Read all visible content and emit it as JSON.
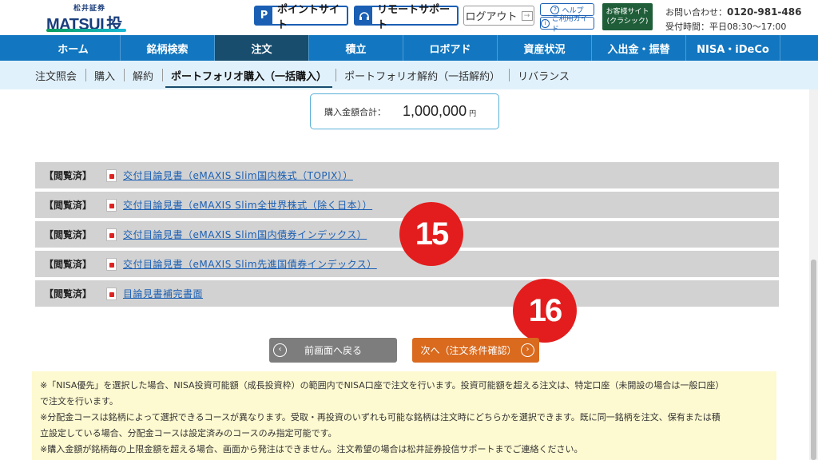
{
  "header": {
    "logo_small": "松井証券",
    "logo_main": "MATSUI",
    "logo_kanji": "投信",
    "point_icon": "P",
    "point_label": "ポイントサイト",
    "remote_label": "リモートサポート",
    "logout_label": "ログアウト",
    "help_label": "ヘルプ",
    "guide_label": "ご利用ガイド",
    "classic_line1": "お客様サイト",
    "classic_line2": "(クラシック)",
    "contact_label": "お問い合わせ：",
    "contact_phone": "0120-981-486",
    "hours": "受付時間：平日08:30～17:00"
  },
  "nav": {
    "items": [
      {
        "label": "ホーム"
      },
      {
        "label": "銘柄検索"
      },
      {
        "label": "注文"
      },
      {
        "label": "積立"
      },
      {
        "label": "ロボアド"
      },
      {
        "label": "資産状況"
      },
      {
        "label": "入出金・振替"
      },
      {
        "label": "NISA・iDeCo"
      }
    ],
    "active_index": 2
  },
  "subnav": {
    "items": [
      {
        "label": "注文照会"
      },
      {
        "label": "購入"
      },
      {
        "label": "解約"
      },
      {
        "label": "ポートフォリオ購入（一括購入）"
      },
      {
        "label": "ポートフォリオ解約（一括解約）"
      },
      {
        "label": "リバランス"
      }
    ],
    "active_index": 3
  },
  "total": {
    "label": "購入金額合計：",
    "value": "1,000,000",
    "unit": "円"
  },
  "documents": [
    {
      "status": "【閲覧済】",
      "title": "交付目論見書（eMAXIS Slim国内株式（TOPIX））"
    },
    {
      "status": "【閲覧済】",
      "title": "交付目論見書（eMAXIS Slim全世界株式（除く日本））"
    },
    {
      "status": "【閲覧済】",
      "title": "交付目論見書（eMAXIS Slim国内債券インデックス）"
    },
    {
      "status": "【閲覧済】",
      "title": "交付目論見書（eMAXIS Slim先進国債券インデックス）"
    },
    {
      "status": "【閲覧済】",
      "title": "目論見書補完書面"
    }
  ],
  "badges": {
    "first": "15",
    "second": "16"
  },
  "actions": {
    "back_label": "前画面へ戻る",
    "next_label": "次へ（注文条件確認）"
  },
  "notes": [
    "※「NISA優先」を選択した場合、NISA投資可能額（成長投資枠）の範囲内でNISA口座で注文を行います。投資可能額を超える注文は、特定口座（未開設の場合は一般口座）",
    "で注文を行います。",
    "※分配金コースは銘柄によって選択できるコースが異なります。受取・再投資のいずれも可能な銘柄は注文時にどちらかを選択できます。既に同一銘柄を注文、保有または積",
    "立設定している場合、分配金コースは設定済みのコースのみ指定可能です。",
    "※購入金額が銘柄毎の上限金額を超える場合、画面から発注はできません。注文希望の場合は松井証券投信サポートまでご連絡ください。"
  ],
  "colors": {
    "nav_bg": "#1277c0",
    "nav_active": "#184d6e",
    "subnav_bg": "#e1f1fb",
    "next_button": "#d96a1e",
    "back_button": "#7d7d7d",
    "badge": "#e31d1d",
    "notes_bg": "#fdf9d0"
  }
}
